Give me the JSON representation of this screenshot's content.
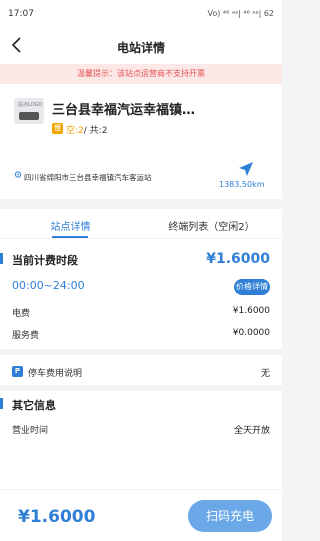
{
  "status_bar": {
    "time": "17:07",
    "indicators": "Vo) ⁴⁶ ᵃᵃ|  ⁴⁶ ᵃᵃ|  62"
  },
  "nav": {
    "title": "电站详情",
    "back_icon": "chevron-left-icon"
  },
  "notice": {
    "text": "温馨提示：该站点运营商不支持开票"
  },
  "station": {
    "name": "三台县幸福汽运幸福镇…",
    "tag": "慢",
    "free_label": "空:2",
    "total_label": "/ 共:2",
    "logo_text": "站点LOGO",
    "address": "四川省绵阳市三台县幸福镇汽车客运站",
    "distance": "1383.50km"
  },
  "tabs": [
    {
      "label": "站点详情",
      "active": true
    },
    {
      "label": "终端列表（空闲2）",
      "active": false
    }
  ],
  "pricing": {
    "section_title": "当前计费时段",
    "current_price": "¥1.6000",
    "time_range": "00:00~24:00",
    "detail_button": "价格详情",
    "electricity_label": "电费",
    "electricity_value": "¥1.6000",
    "service_label": "服务费",
    "service_value": "¥0.0000"
  },
  "parking": {
    "icon_text": "P",
    "label": "停车费用说明",
    "value": "无"
  },
  "other_info": {
    "section_title": "其它信息",
    "hours_label": "营业时间",
    "hours_value": "全天开放"
  },
  "bottom": {
    "price": "¥1.6000",
    "scan_button": "扫码充电"
  },
  "colors": {
    "accent": "#2f7fd6",
    "notice_bg": "#fde8e8",
    "notice_text": "#e55353",
    "tag": "#f0a500"
  }
}
